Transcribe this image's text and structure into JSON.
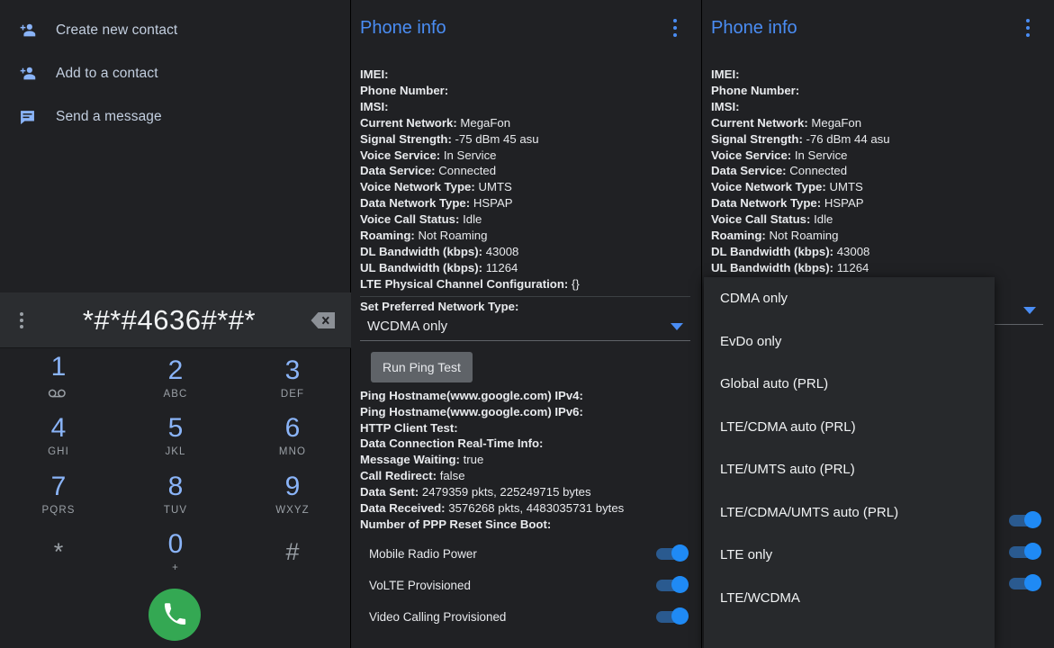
{
  "dialer": {
    "contact_actions": [
      {
        "icon": "person-add-icon",
        "label": "Create new contact"
      },
      {
        "icon": "person-add-icon",
        "label": "Add to a contact"
      },
      {
        "icon": "message-icon",
        "label": "Send a message"
      }
    ],
    "overflow_icon": "overflow-menu-icon",
    "entered_number": "*#*#4636#*#*",
    "backspace_icon": "backspace-icon",
    "call_icon": "call-icon",
    "keys": [
      {
        "digit": "1",
        "sub": "",
        "voicemail": true
      },
      {
        "digit": "2",
        "sub": "ABC"
      },
      {
        "digit": "3",
        "sub": "DEF"
      },
      {
        "digit": "4",
        "sub": "GHI"
      },
      {
        "digit": "5",
        "sub": "JKL"
      },
      {
        "digit": "6",
        "sub": "MNO"
      },
      {
        "digit": "7",
        "sub": "PQRS"
      },
      {
        "digit": "8",
        "sub": "TUV"
      },
      {
        "digit": "9",
        "sub": "WXYZ"
      },
      {
        "digit": "*",
        "sub": ""
      },
      {
        "digit": "0",
        "sub": "+"
      },
      {
        "digit": "#",
        "sub": ""
      }
    ]
  },
  "panel_middle": {
    "title": "Phone info",
    "overflow_icon": "overflow-menu-icon",
    "fields": [
      {
        "key": "IMEI:",
        "value": ""
      },
      {
        "key": "Phone Number:",
        "value": ""
      },
      {
        "key": "IMSI:",
        "value": ""
      },
      {
        "key": "Current Network:",
        "value": "MegaFon"
      },
      {
        "key": "Signal Strength:",
        "value": "-75 dBm   45 asu"
      },
      {
        "key": "Voice Service:",
        "value": "In Service"
      },
      {
        "key": "Data Service:",
        "value": "Connected"
      },
      {
        "key": "Voice Network Type:",
        "value": "UMTS"
      },
      {
        "key": "Data Network Type:",
        "value": "HSPAP"
      },
      {
        "key": "Voice Call Status:",
        "value": "Idle"
      },
      {
        "key": "Roaming:",
        "value": "Not Roaming"
      },
      {
        "key": "DL Bandwidth (kbps):",
        "value": "43008"
      },
      {
        "key": "UL Bandwidth (kbps):",
        "value": "11264"
      },
      {
        "key": "LTE Physical Channel Configuration:",
        "value": "{}"
      }
    ],
    "pref_label": "Set Preferred Network Type:",
    "pref_selected": "WCDMA only",
    "ping_button": "Run Ping Test",
    "fields2": [
      {
        "key": "Ping Hostname(www.google.com) IPv4:",
        "value": ""
      },
      {
        "key": "Ping Hostname(www.google.com) IPv6:",
        "value": ""
      },
      {
        "key": "HTTP Client Test:",
        "value": ""
      },
      {
        "key": "Data Connection Real-Time Info:",
        "value": ""
      },
      {
        "key": "Message Waiting:",
        "value": "true"
      },
      {
        "key": "Call Redirect:",
        "value": "false"
      },
      {
        "key": "Data Sent:",
        "value": "2479359 pkts, 225249715 bytes"
      },
      {
        "key": "Data Received:",
        "value": "3576268 pkts, 4483035731 bytes"
      },
      {
        "key": "Number of PPP Reset Since Boot:",
        "value": ""
      }
    ],
    "toggles": [
      {
        "label": "Mobile Radio Power",
        "on": true
      },
      {
        "label": "VoLTE Provisioned",
        "on": true
      },
      {
        "label": "Video Calling Provisioned",
        "on": true
      }
    ]
  },
  "panel_right": {
    "title": "Phone info",
    "overflow_icon": "overflow-menu-icon",
    "fields": [
      {
        "key": "IMEI:",
        "value": ""
      },
      {
        "key": "Phone Number:",
        "value": ""
      },
      {
        "key": "IMSI:",
        "value": ""
      },
      {
        "key": "Current Network:",
        "value": "MegaFon"
      },
      {
        "key": "Signal Strength:",
        "value": "-76 dBm   44 asu"
      },
      {
        "key": "Voice Service:",
        "value": "In Service"
      },
      {
        "key": "Data Service:",
        "value": "Connected"
      },
      {
        "key": "Voice Network Type:",
        "value": "UMTS"
      },
      {
        "key": "Data Network Type:",
        "value": "HSPAP"
      },
      {
        "key": "Voice Call Status:",
        "value": "Idle"
      },
      {
        "key": "Roaming:",
        "value": "Not Roaming"
      },
      {
        "key": "DL Bandwidth (kbps):",
        "value": "43008"
      },
      {
        "key": "UL Bandwidth (kbps):",
        "value": "11264"
      }
    ],
    "toggles": [
      {
        "label": "",
        "on": true
      },
      {
        "label": "",
        "on": true
      },
      {
        "label": "",
        "on": true
      }
    ]
  },
  "dropdown": {
    "options": [
      "CDMA only",
      "EvDo only",
      "Global auto (PRL)",
      "LTE/CDMA auto (PRL)",
      "LTE/UMTS auto (PRL)",
      "LTE/CDMA/UMTS auto (PRL)",
      "LTE only",
      "LTE/WCDMA"
    ]
  },
  "colors": {
    "background": "#202124",
    "accent_blue": "#4a8df4",
    "key_blue": "#8ab4f8",
    "call_green": "#34a853",
    "toggle_on": "#1f8af5"
  }
}
